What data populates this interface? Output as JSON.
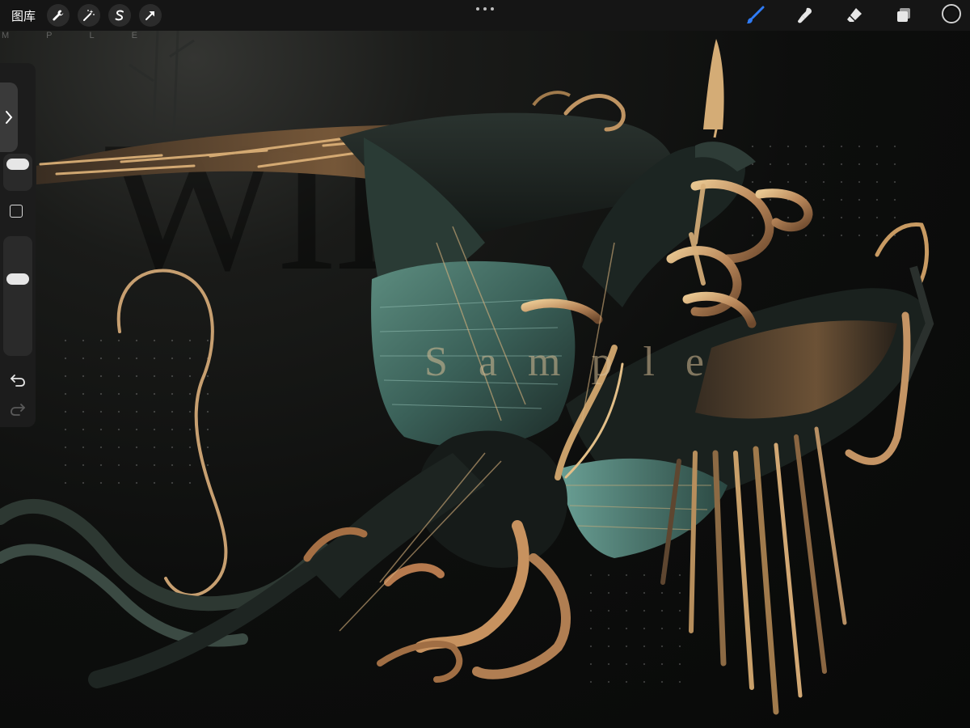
{
  "toolbar": {
    "gallery_label": "图库",
    "left_tools": [
      {
        "icon": "wrench-icon",
        "name": "actions-button"
      },
      {
        "icon": "magic-wand-icon",
        "name": "adjustments-button"
      },
      {
        "icon": "selection-s-icon",
        "name": "selection-button"
      },
      {
        "icon": "arrow-cursor-icon",
        "name": "transform-button"
      }
    ],
    "right_tools": [
      {
        "icon": "brush-icon",
        "name": "brush-tool-button",
        "active": true
      },
      {
        "icon": "smudge-icon",
        "name": "smudge-tool-button",
        "active": false
      },
      {
        "icon": "eraser-icon",
        "name": "eraser-tool-button",
        "active": false
      },
      {
        "icon": "layers-icon",
        "name": "layers-button",
        "active": false
      }
    ],
    "current_color": "#141414",
    "active_color": "#2f7bf5"
  },
  "sidebar": {
    "brush_size_level": 0.95,
    "opacity_level": 0.65
  },
  "canvas": {
    "watermark": "Sample",
    "letter_strip": "MPLE",
    "background_text": "WII"
  }
}
